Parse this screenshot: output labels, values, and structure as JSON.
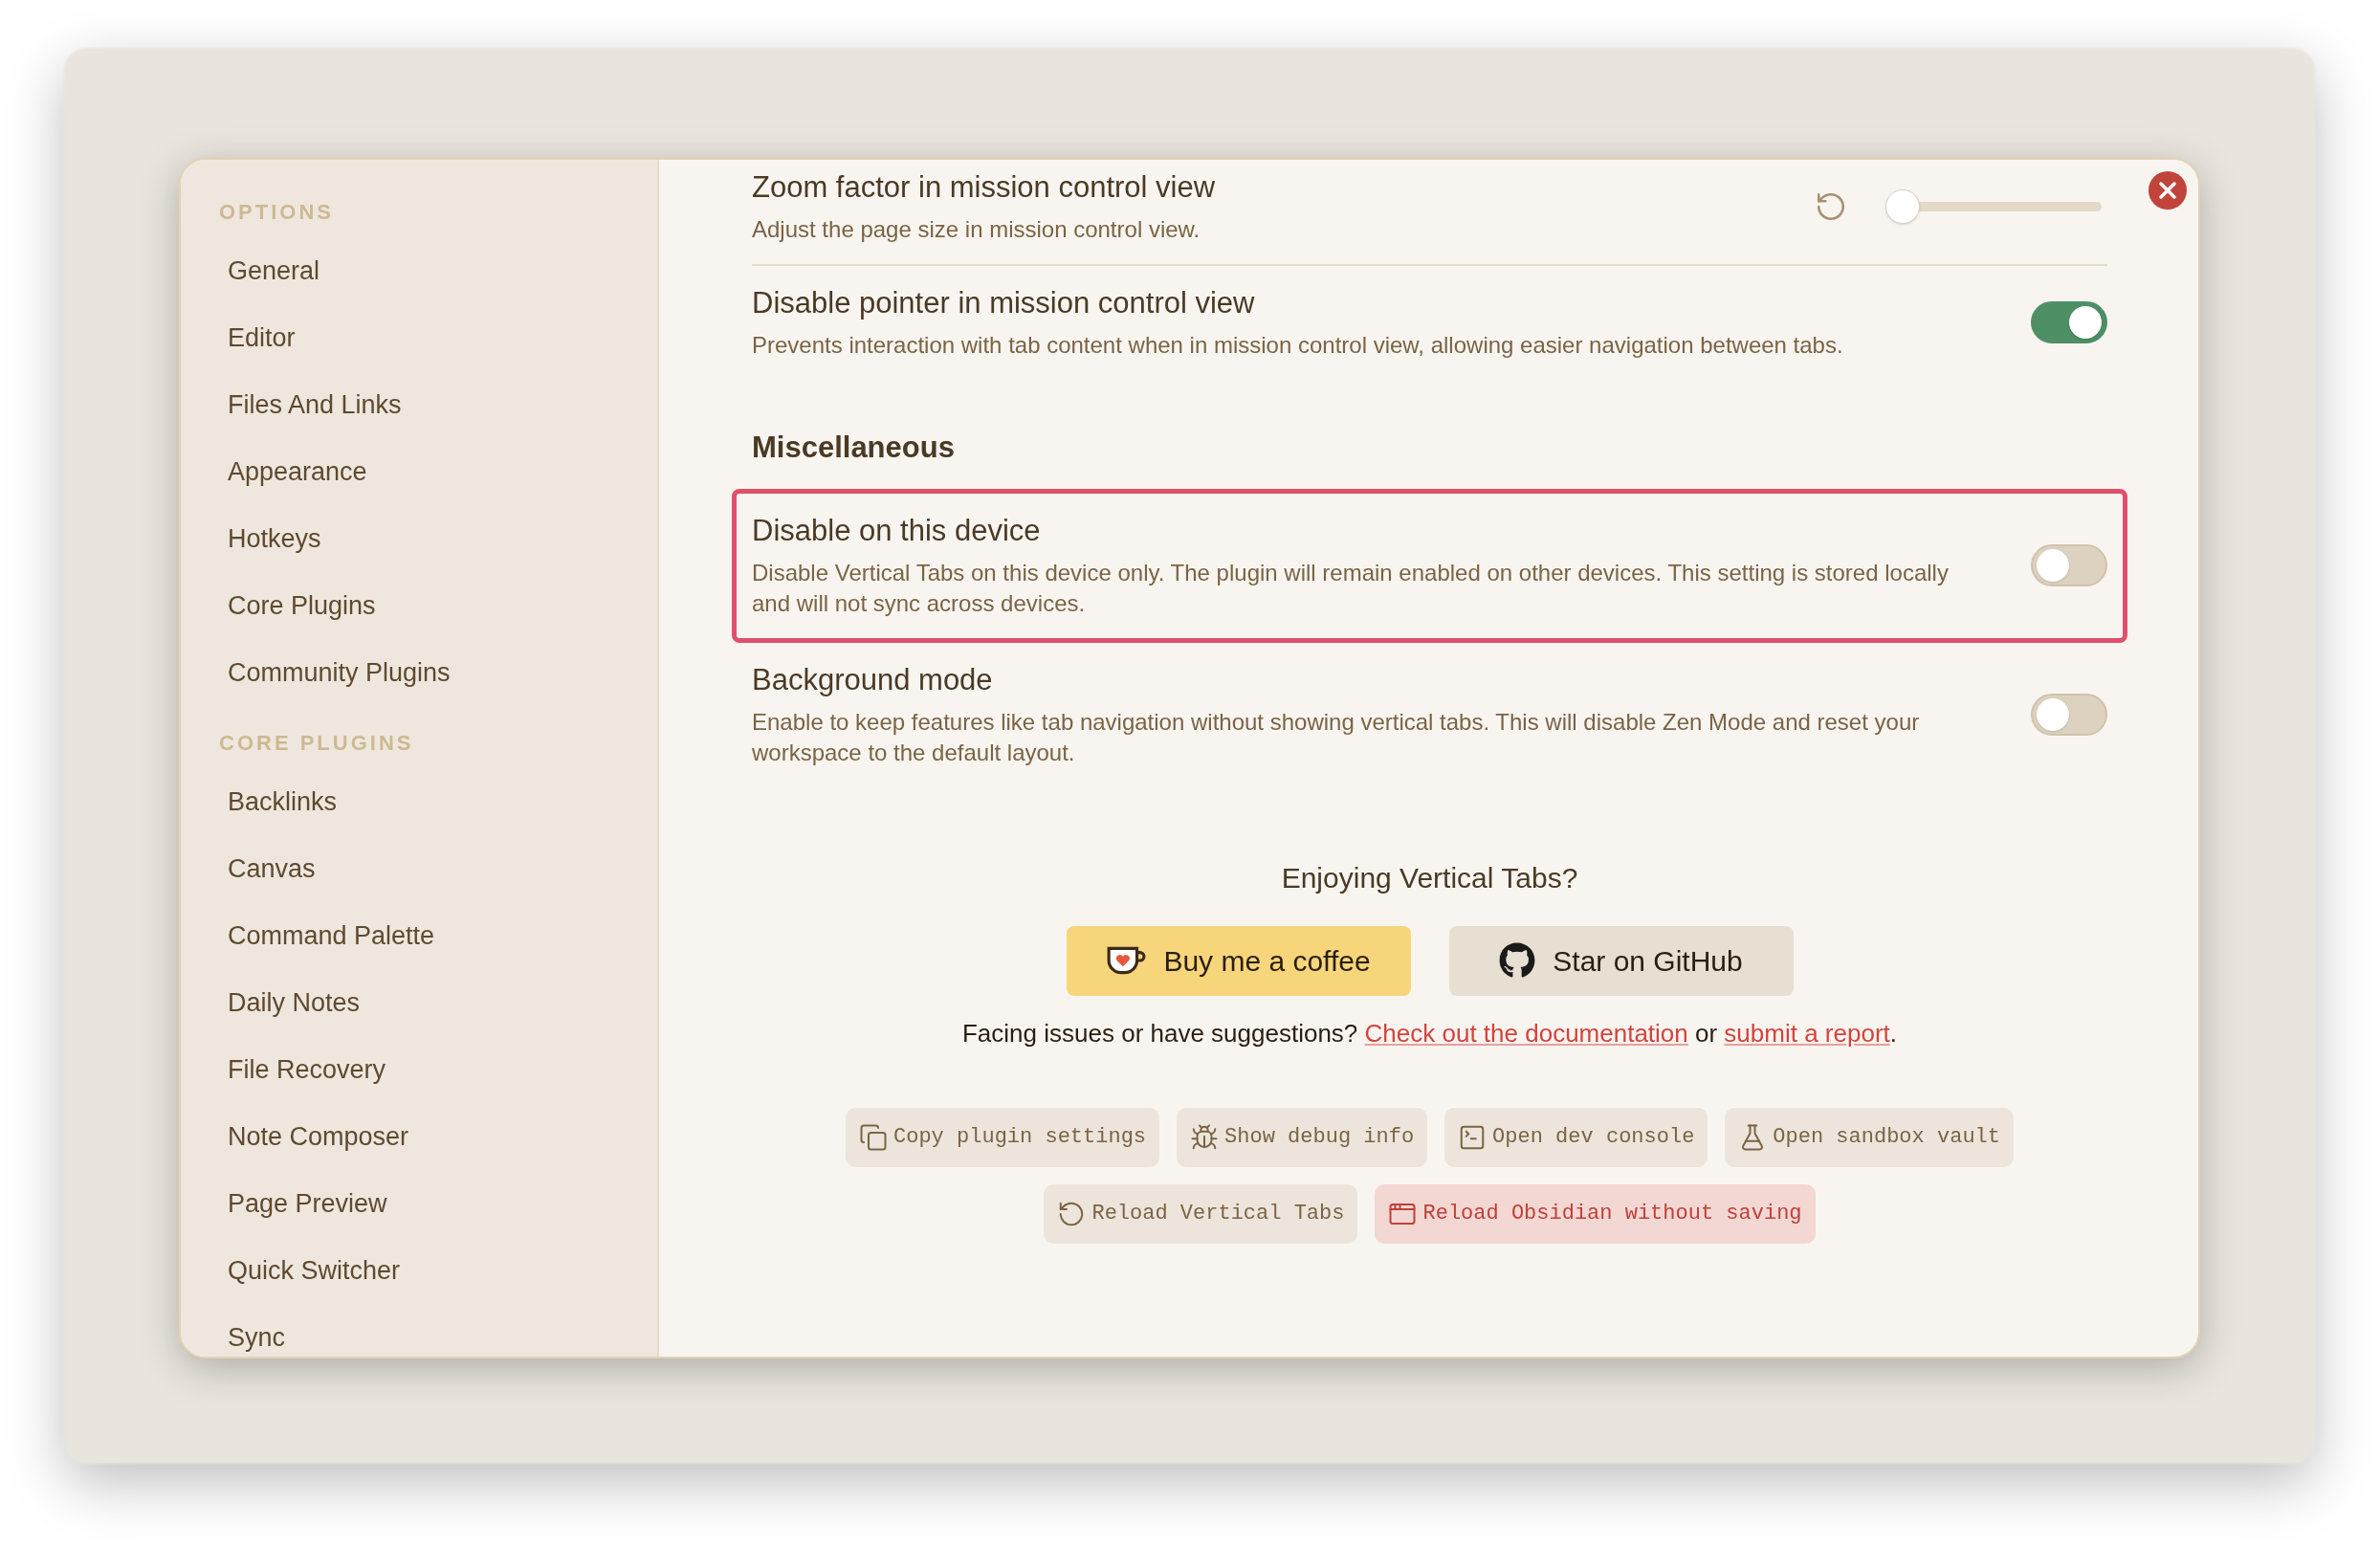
{
  "sidebar": {
    "sections": [
      {
        "heading": "OPTIONS",
        "items": [
          {
            "label": "General"
          },
          {
            "label": "Editor"
          },
          {
            "label": "Files And Links"
          },
          {
            "label": "Appearance"
          },
          {
            "label": "Hotkeys"
          },
          {
            "label": "Core Plugins"
          },
          {
            "label": "Community Plugins"
          }
        ]
      },
      {
        "heading": "CORE PLUGINS",
        "items": [
          {
            "label": "Backlinks"
          },
          {
            "label": "Canvas"
          },
          {
            "label": "Command Palette"
          },
          {
            "label": "Daily Notes"
          },
          {
            "label": "File Recovery"
          },
          {
            "label": "Note Composer"
          },
          {
            "label": "Page Preview"
          },
          {
            "label": "Quick Switcher"
          },
          {
            "label": "Sync"
          }
        ]
      }
    ]
  },
  "settings": [
    {
      "kind": "slider",
      "title": "Zoom factor in mission control view",
      "description": "Adjust the page size in mission control view.",
      "level": 0
    },
    {
      "kind": "toggle",
      "title": "Disable pointer in mission control view",
      "description": "Prevents interaction with tab content when in mission control view, allowing easier navigation between tabs.",
      "on": true,
      "highlighted": false
    },
    {
      "kind": "heading",
      "title": "Miscellaneous"
    },
    {
      "kind": "toggle",
      "title": "Disable on this device",
      "description": "Disable Vertical Tabs on this device only. The plugin will remain enabled on other devices. This setting is stored locally and will not sync across devices.",
      "on": false,
      "highlighted": true
    },
    {
      "kind": "toggle",
      "title": "Background mode",
      "description": "Enable to keep features like tab navigation without showing vertical tabs. This will disable Zen Mode and reset your workspace to the default layout.",
      "on": false,
      "highlighted": false
    }
  ],
  "support": {
    "title": "Enjoying Vertical Tabs?",
    "buttons": [
      {
        "kind": "coffee",
        "label": "Buy me a coffee"
      },
      {
        "kind": "github",
        "label": "Star on GitHub"
      }
    ],
    "footer": [
      {
        "kind": "text",
        "text": "Facing issues or have suggestions? "
      },
      {
        "kind": "link",
        "text": "Check out the documentation"
      },
      {
        "kind": "text",
        "text": " or "
      },
      {
        "kind": "link",
        "text": "submit a report"
      },
      {
        "kind": "text",
        "text": "."
      }
    ]
  },
  "tools": [
    [
      {
        "kind": "copy",
        "label": "Copy plugin settings",
        "danger": false
      },
      {
        "kind": "bug",
        "label": "Show debug info",
        "danger": false
      },
      {
        "kind": "terminal",
        "label": "Open dev console",
        "danger": false
      },
      {
        "kind": "flask",
        "label": "Open sandbox vault",
        "danger": false
      }
    ],
    [
      {
        "kind": "reload",
        "label": "Reload Vertical Tabs",
        "danger": false
      },
      {
        "kind": "window",
        "label": "Reload Obsidian without saving",
        "danger": true
      }
    ]
  ]
}
